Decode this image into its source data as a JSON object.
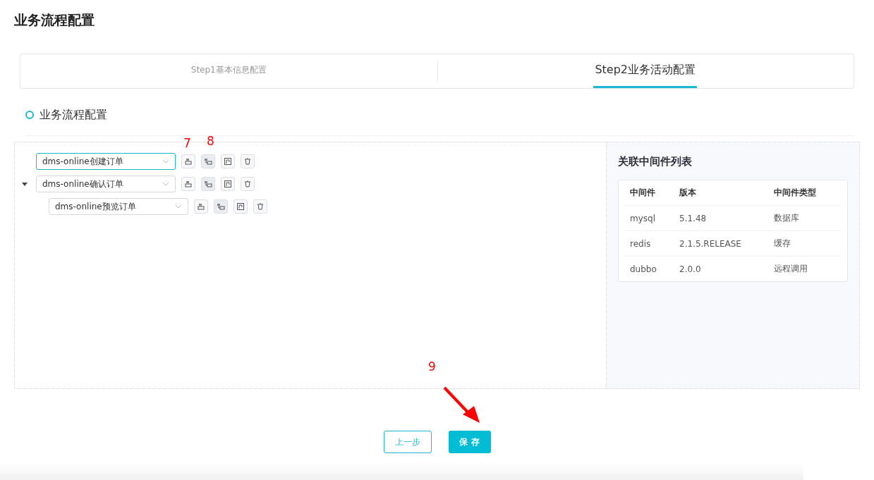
{
  "page_title": "业务流程配置",
  "steps": [
    {
      "label": "Step1基本信息配置",
      "selected": false
    },
    {
      "label": "Step2业务活动配置",
      "selected": true
    }
  ],
  "section_title": "业务流程配置",
  "tree": [
    {
      "value": "dms-online创建订单",
      "focused": true
    },
    {
      "value": "dms-online确认订单",
      "focused": false,
      "expanded": true,
      "children": [
        {
          "value": "dms-online预览订单",
          "focused": false
        }
      ]
    }
  ],
  "middleware": {
    "title": "关联中间件列表",
    "columns": [
      "中间件",
      "版本",
      "中间件类型"
    ],
    "rows": [
      [
        "mysql",
        "5.1.48",
        "数据库"
      ],
      [
        "redis",
        "2.1.5.RELEASE",
        "缓存"
      ],
      [
        "dubbo",
        "2.0.0",
        "远程调用"
      ]
    ]
  },
  "buttons": {
    "prev": "上一步",
    "save": "保 存"
  },
  "annotations": [
    "7",
    "8",
    "9"
  ]
}
